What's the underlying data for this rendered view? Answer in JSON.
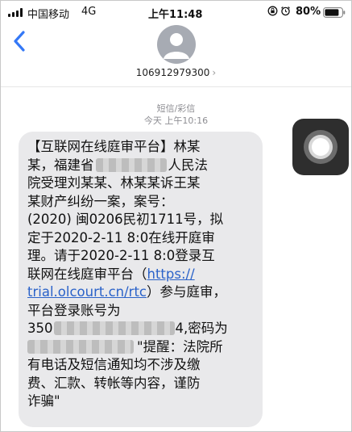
{
  "status_bar": {
    "carrier": "中国移动",
    "network": "4G",
    "time": "上午11:48",
    "battery": "80%"
  },
  "contact": {
    "number": "106912979300",
    "chevron": "›"
  },
  "thread": {
    "type": "短信/彩信",
    "timestamp": "今天 上午10:16"
  },
  "message": {
    "line1": "【互联网在线庭审平台】林某",
    "line2a": "某，福建省",
    "line2b": "人民法",
    "line3": "院受理刘某某、林某某诉王某",
    "line4": "某财产纠纷一案，案号：",
    "line5": "(2020) 闽0206民初1711号，拟",
    "line6": "定于2020-2-11 8:0在线开庭审",
    "line7": "理。请于2020-2-11 8:0登录互",
    "line8a": "联网在线庭审平台（",
    "line8_link": "https://",
    "line9_link": "trial.olcourt.cn/rtc",
    "line9b": "）参与庭审，",
    "line10": "平台登录账号为",
    "line11a": "350",
    "line11b": "4,密码为",
    "line12b": "\"提醒：法院所",
    "line13": "有电话及短信通知均不涉及缴",
    "line14": "费、汇款、转帐等内容，谨防",
    "line15": "诈骗\""
  },
  "colors": {
    "link": "#2a62c9",
    "bubble": "#e9e9eb",
    "back_accent": "#3478f6"
  },
  "icons": [
    "back-chevron-icon",
    "contact-avatar-icon",
    "lock-rotation-icon",
    "alarm-icon",
    "battery-icon",
    "signal-icon",
    "assistive-touch-icon"
  ]
}
